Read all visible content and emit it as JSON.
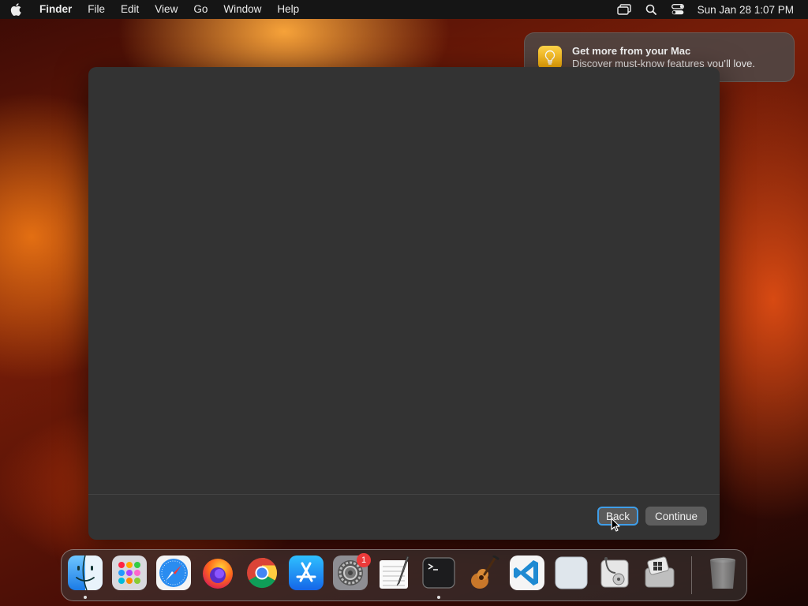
{
  "menubar": {
    "app_name": "Finder",
    "items": [
      "File",
      "Edit",
      "View",
      "Go",
      "Window",
      "Help"
    ],
    "clock": "Sun Jan 28  1:07 PM"
  },
  "notification": {
    "title": "Get more from your Mac",
    "body": "Discover must-know features you’ll love.",
    "icon": "lightbulb-icon"
  },
  "window": {
    "back_label": "Back",
    "continue_label": "Continue"
  },
  "dock": {
    "apps": [
      {
        "name": "finder",
        "running": true
      },
      {
        "name": "launchpad"
      },
      {
        "name": "safari"
      },
      {
        "name": "firefox"
      },
      {
        "name": "chrome"
      },
      {
        "name": "app-store"
      },
      {
        "name": "system-settings",
        "badge": "1"
      },
      {
        "name": "textedit"
      },
      {
        "name": "terminal",
        "running": true
      },
      {
        "name": "garageband"
      },
      {
        "name": "vscode"
      },
      {
        "name": "preview"
      },
      {
        "name": "disk-utility"
      },
      {
        "name": "boot-camp-assistant"
      },
      {
        "name": "trash"
      }
    ]
  },
  "colors": {
    "accent": "#3f9ee9",
    "window_bg": "#333333",
    "badge": "#ec3a3a"
  }
}
